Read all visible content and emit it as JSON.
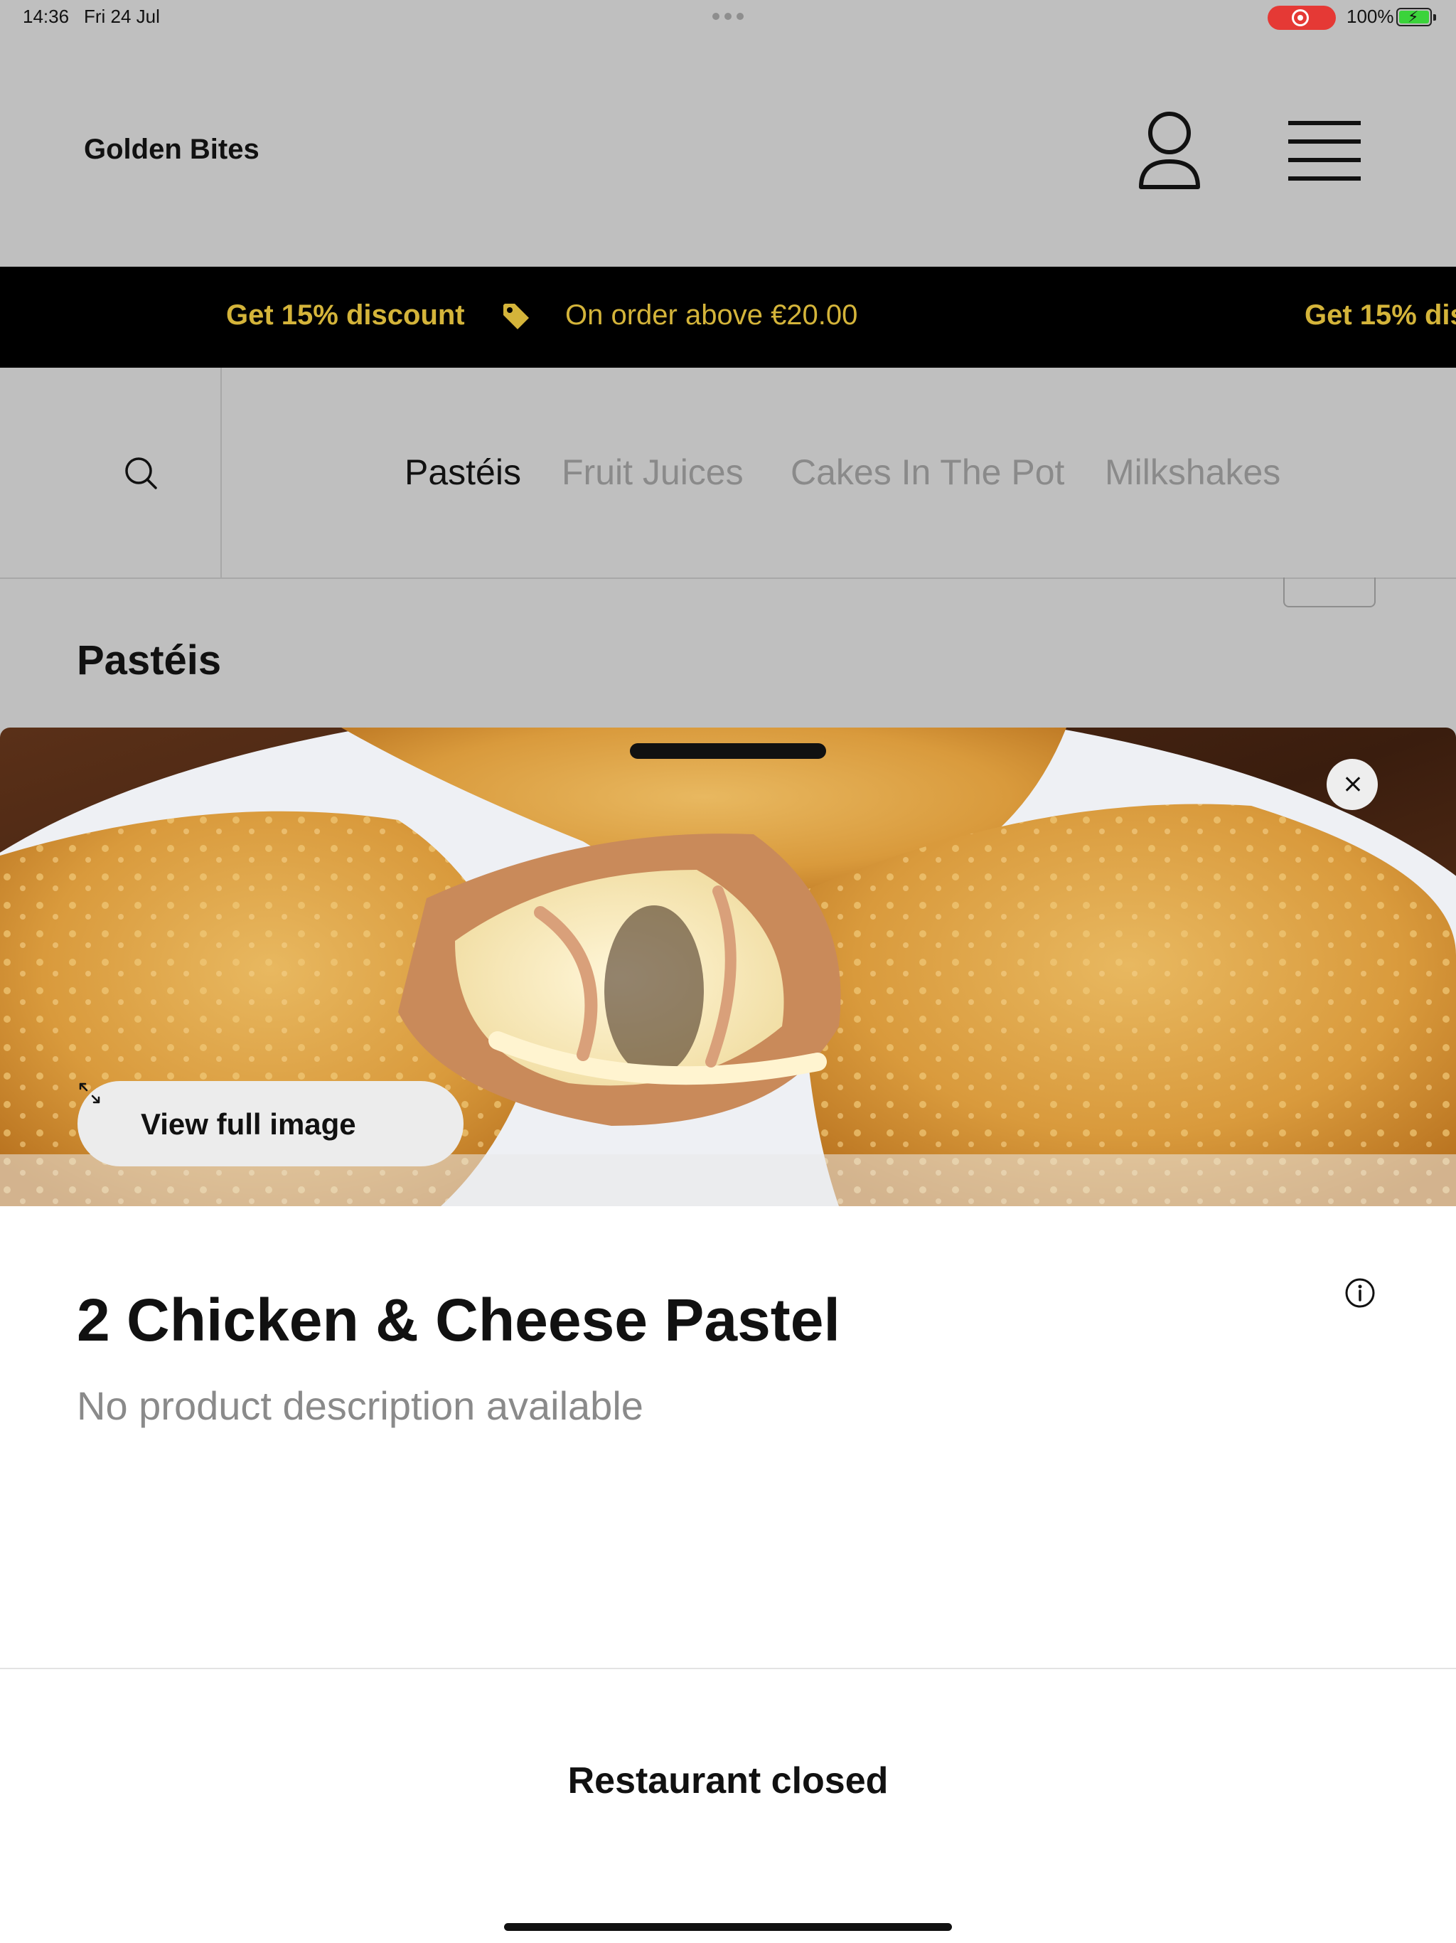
{
  "status_bar": {
    "time": "14:36",
    "date": "Fri 24 Jul",
    "battery": "100%",
    "recording_color": "#e53935"
  },
  "header": {
    "brand": "Golden Bites",
    "profile_icon": "person-outline-icon",
    "menu_icon": "hamburger-menu-icon"
  },
  "promo_banner": {
    "headline": "Get 15% discount",
    "detail": "On order above €20.00",
    "headline_repeat": "Get 15% discount",
    "icon": "tag-icon",
    "text_color": "#d4b43a",
    "background": "#000000"
  },
  "categories": {
    "search_icon": "search-icon",
    "tabs": [
      {
        "label": "Pastéis",
        "active": true
      },
      {
        "label": "Fruit Juices",
        "active": false
      },
      {
        "label": "Cakes In The Pot",
        "active": false
      },
      {
        "label": "Milkshakes",
        "active": false
      }
    ]
  },
  "section": {
    "heading": "Pastéis"
  },
  "product_modal": {
    "view_full_image_label": "View full image",
    "title": "2 Chicken & Cheese Pastel",
    "description": "No product description available",
    "status": "Restaurant closed",
    "icons": [
      "close-icon",
      "expand-icon",
      "info-icon"
    ]
  }
}
